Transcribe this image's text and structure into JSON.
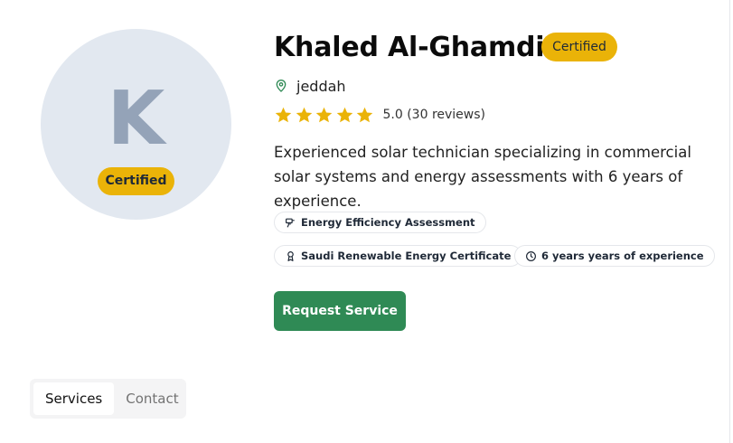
{
  "profile": {
    "initial": "K",
    "avatar_badge": "Certified",
    "name": "Khaled Al-Ghamdi",
    "title_badge": "Certified",
    "location": "jeddah",
    "rating": 5.0,
    "rating_text": "5.0 (30 reviews)",
    "description": "Experienced solar technician specializing in commercial solar systems and energy assessments with 6 years of experience."
  },
  "chips": [
    {
      "label": "Energy Efficiency Assessment",
      "icon": "tool-icon"
    },
    {
      "label": "Saudi Renewable Energy Certificate",
      "icon": "award-icon"
    },
    {
      "label": "6 years years of experience",
      "icon": "clock-icon"
    }
  ],
  "actions": {
    "request_label": "Request Service"
  },
  "tabs": [
    {
      "label": "Services",
      "active": true
    },
    {
      "label": "Contact",
      "active": false
    }
  ],
  "colors": {
    "accent_green": "#2f8a55",
    "badge_yellow": "#eab308",
    "star_yellow": "#eab308",
    "avatar_bg": "#e2e8f0"
  }
}
